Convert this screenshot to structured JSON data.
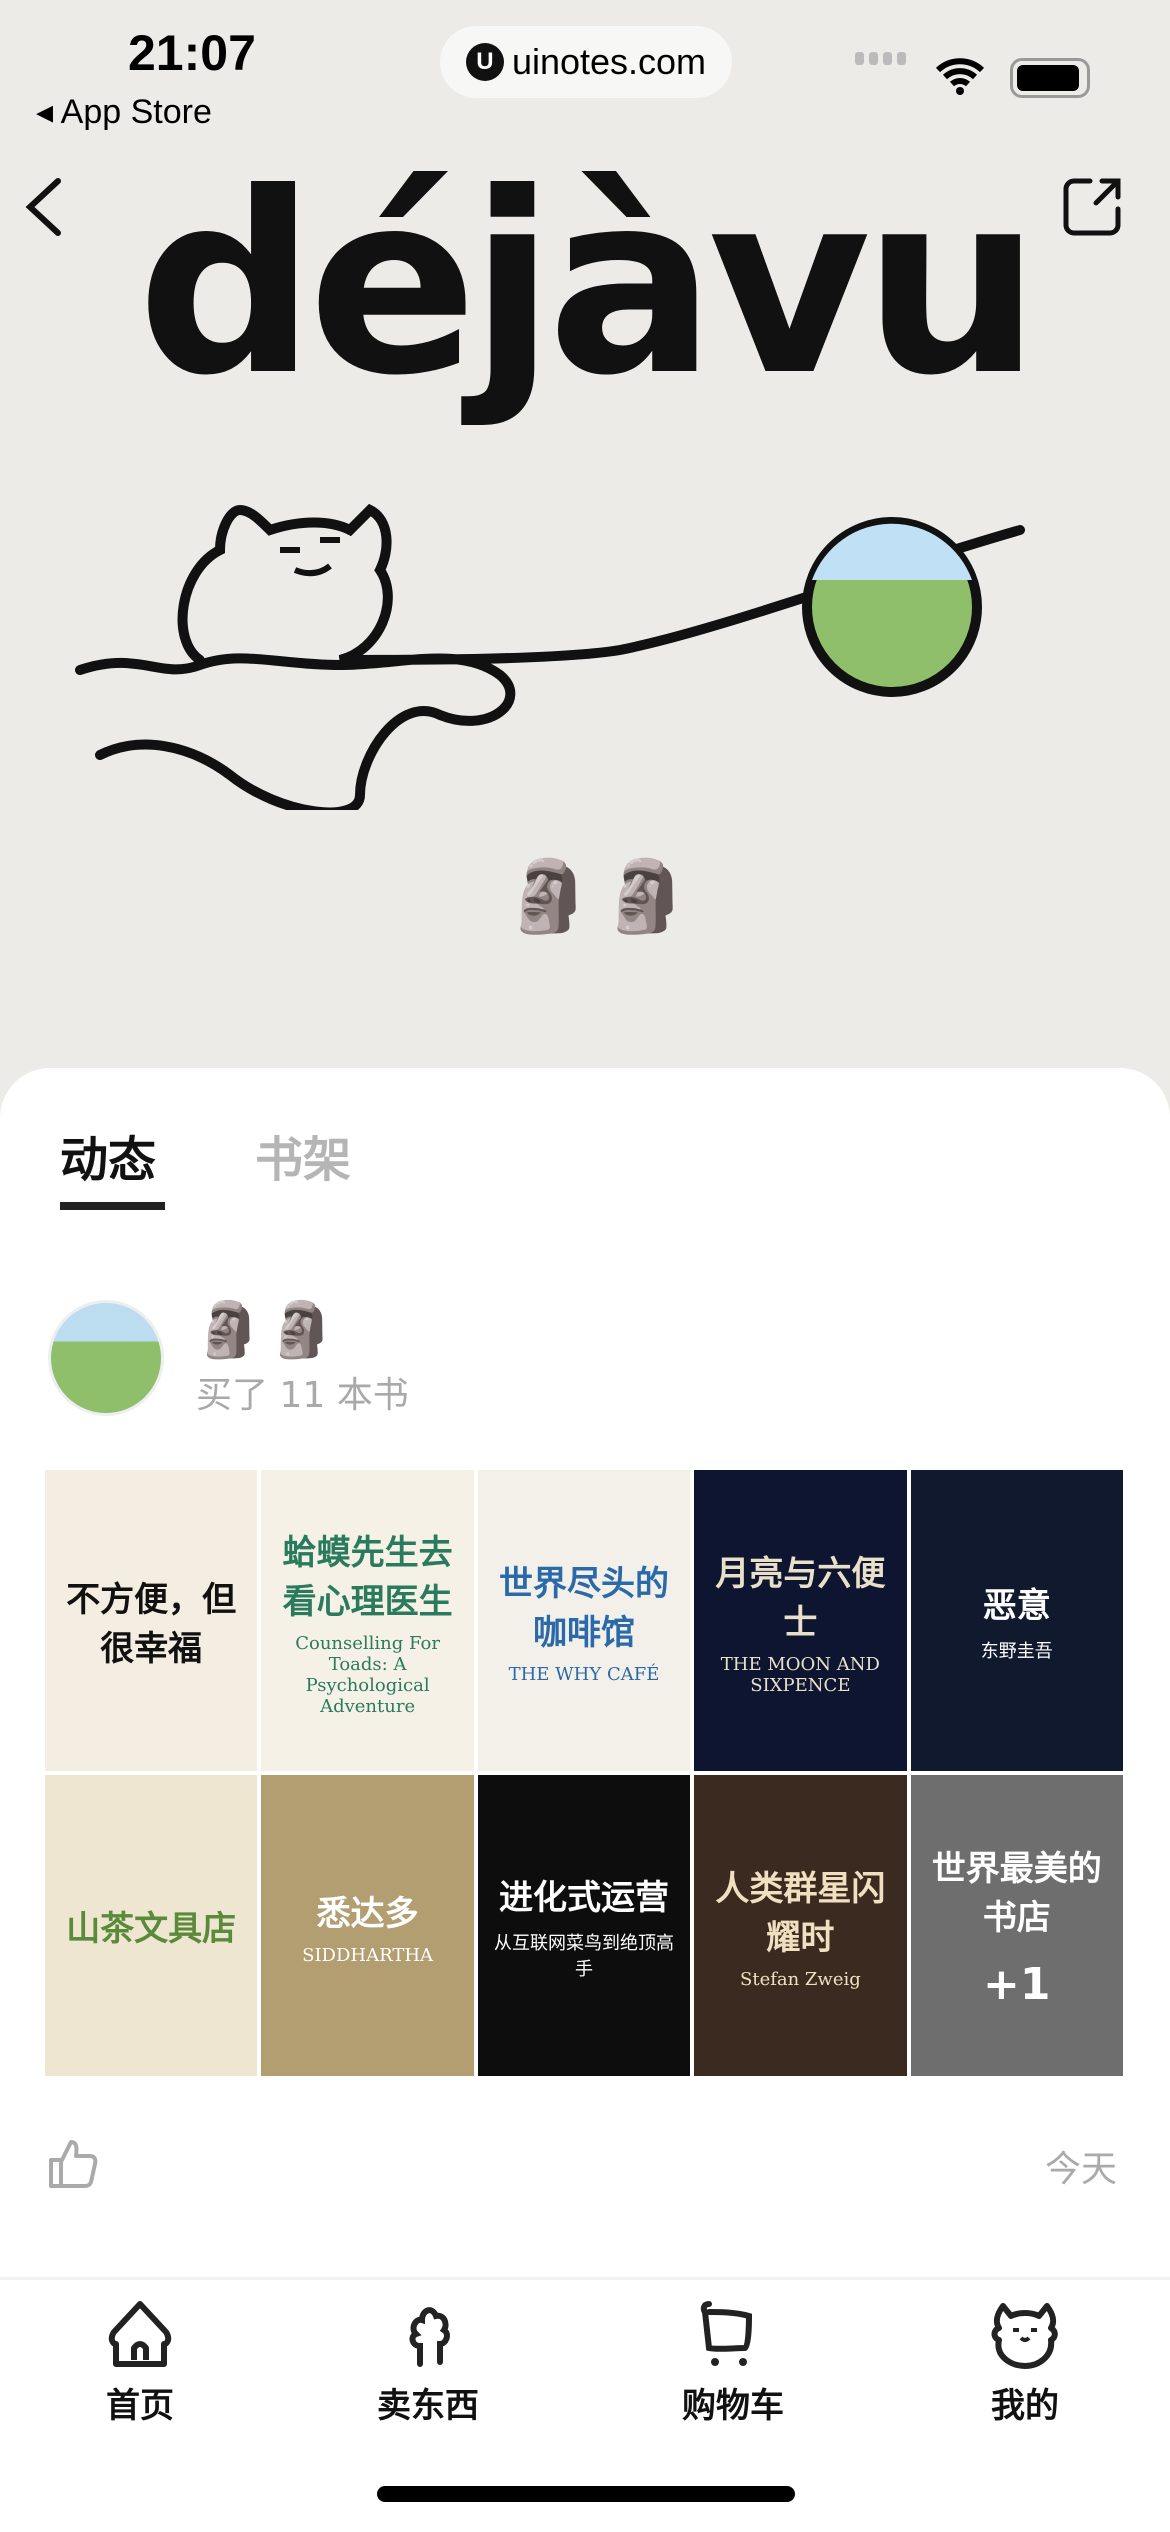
{
  "status": {
    "time": "21:07",
    "back_app": "App Store",
    "url": "uinotes.com",
    "url_logo": "U"
  },
  "hero": {
    "title": "déjàvu",
    "emoji": "🗿🗿"
  },
  "tabs": [
    {
      "label": "动态",
      "active": true
    },
    {
      "label": "书架",
      "active": false
    }
  ],
  "post": {
    "username": "🗿🗿",
    "action": "买了 11 本书",
    "time": "今天",
    "books": [
      {
        "title": "不方便，但很幸福",
        "bg": "#f3ede2",
        "fg": "#111"
      },
      {
        "title": "蛤蟆先生去看心理医生",
        "subtitle": "Counselling For Toads: A Psychological Adventure",
        "bg": "#f5f1e6",
        "fg": "#2a7a5e"
      },
      {
        "title": "世界尽头的咖啡馆",
        "subtitle": "THE WHY CAFÉ",
        "bg": "#f3f0ea",
        "fg": "#2a6aa8"
      },
      {
        "title": "月亮与六便士",
        "subtitle": "THE MOON AND SIXPENCE",
        "bg": "#0e1530",
        "fg": "#e8e0c8"
      },
      {
        "title": "恶意",
        "subtitle": "东野圭吾",
        "bg": "#10192e",
        "fg": "#fff"
      },
      {
        "title": "山茶文具店",
        "bg": "#efe6d2",
        "fg": "#5a8a3a"
      },
      {
        "title": "悉达多",
        "subtitle": "SIDDHARTHA",
        "bg": "#b39e72",
        "fg": "#fff"
      },
      {
        "title": "进化式运营",
        "subtitle": "从互联网菜鸟到绝顶高手",
        "bg": "#0d0d0d",
        "fg": "#fff"
      },
      {
        "title": "人类群星闪耀时",
        "subtitle": "Stefan Zweig",
        "bg": "#3a2a20",
        "fg": "#f0e0c0"
      },
      {
        "title": "世界最美的书店",
        "extra": "+1",
        "bg": "#6e6e6e",
        "fg": "#fff"
      }
    ]
  },
  "tabbar": [
    {
      "label": "首页",
      "icon": "home-icon"
    },
    {
      "label": "卖东西",
      "icon": "tree-icon"
    },
    {
      "label": "购物车",
      "icon": "cart-icon"
    },
    {
      "label": "我的",
      "icon": "cat-face-icon"
    }
  ]
}
